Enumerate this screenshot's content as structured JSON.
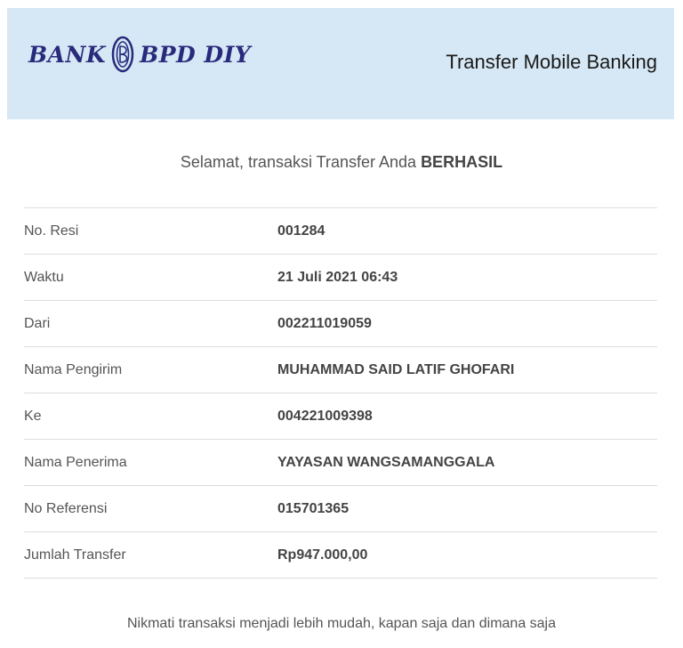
{
  "header": {
    "logo_left": "BANK",
    "logo_right": "BPD DIY",
    "title": "Transfer Mobile Banking"
  },
  "status": {
    "message_prefix": "Selamat, transaksi Transfer Anda",
    "message_status": "BERHASIL"
  },
  "details": [
    {
      "label": "No. Resi",
      "value": "001284"
    },
    {
      "label": "Waktu",
      "value": "21 Juli 2021 06:43"
    },
    {
      "label": "Dari",
      "value": "002211019059"
    },
    {
      "label": "Nama Pengirim",
      "value": "MUHAMMAD SAID LATIF GHOFARI"
    },
    {
      "label": "Ke",
      "value": "004221009398"
    },
    {
      "label": "Nama Penerima",
      "value": "YAYASAN WANGSAMANGGALA"
    },
    {
      "label": "No Referensi",
      "value": "015701365"
    },
    {
      "label": "Jumlah Transfer",
      "value": "Rp947.000,00"
    }
  ],
  "footer": {
    "message": "Nikmati transaksi menjadi lebih mudah, kapan saja dan dimana saja"
  },
  "colors": {
    "header_bg": "#d6e8f5",
    "logo": "#2a2a7c"
  }
}
